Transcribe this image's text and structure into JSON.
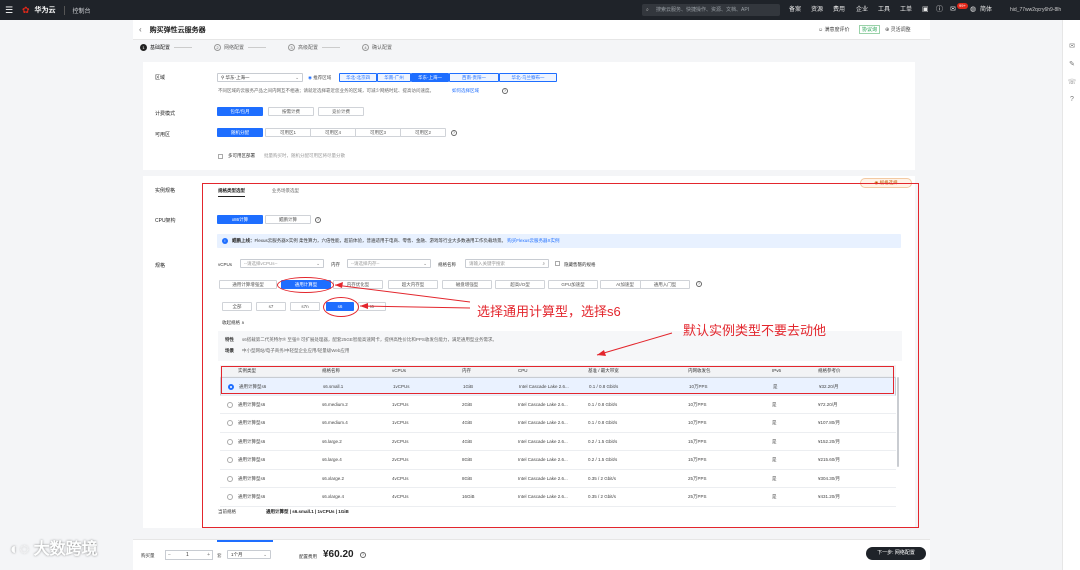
{
  "topbar": {
    "menu_icon": "☰",
    "logo": "✿",
    "brand": "华为云",
    "console": "控制台",
    "search_placeholder": "搜索云服务、快捷操作、资源、文档、API",
    "nav": [
      "备案",
      "资源",
      "费用",
      "企业",
      "工具",
      "工单"
    ],
    "badge": "99+",
    "lang": "简体",
    "user": "hid_77ww2qcry6h9-8lh"
  },
  "header": {
    "back": "‹",
    "title": "购买弹性云服务器",
    "eval": "满意度评价",
    "service": "协议询",
    "flag": "灵活调整"
  },
  "steps": [
    {
      "n": "1",
      "label": "基础配置"
    },
    {
      "n": "2",
      "label": "网络配置"
    },
    {
      "n": "3",
      "label": "高级配置"
    },
    {
      "n": "4",
      "label": "确认配置"
    }
  ],
  "region": {
    "label": "区域",
    "value": "华东-上海一",
    "recommend": "推荐区域",
    "options": [
      "华北-北京四",
      "华南-广州",
      "华东-上海一",
      "西南-贵阳一",
      "华北-乌兰察布一"
    ],
    "note": "不同区域的云服务产品之间内网互不相通；请就近选择靠近您业务的区域，可减少网络时延、提高访问速度。",
    "note_link": "如何选择区域"
  },
  "billing": {
    "label": "计费模式",
    "options": [
      "包年/包月",
      "按需计费",
      "竞价计费"
    ]
  },
  "az": {
    "label": "可用区",
    "options": [
      "随机分配",
      "可用区1",
      "可用区4",
      "可用区3",
      "可用区2"
    ],
    "multi_label": "多可用区部署",
    "multi_note": "批量购买时，随机分配可用区将尽量分散"
  },
  "instance": {
    "label": "实例规格",
    "tabs": [
      "规格类型选型",
      "业务场景选型"
    ],
    "float_btn": "◉ 规格选择"
  },
  "cpu": {
    "label": "CPU架构",
    "options": [
      "x86计算",
      "鲲鹏计算"
    ]
  },
  "info": {
    "bold": "鲲鹏上线：",
    "text": "Flexus云服务器X实例 柔性算力，六倍性能，超前体验，普遍适用于电商、零售、金融、游戏等行业大多数通用工作负载场景。",
    "link": "购买Flexus云服务器X实例"
  },
  "spec": {
    "label": "规格",
    "vcpu_label": "vCPUs",
    "vcpu_placeholder": "--请选择vCPUs--",
    "mem_label": "内存",
    "mem_placeholder": "--请选择内存--",
    "name_label": "规格名称",
    "name_placeholder": "请输入关键字搜索",
    "hide_soldout": "隐藏售罄的规格"
  },
  "families": [
    "通用计算增强型",
    "通用计算型",
    "内存优化型",
    "超大内存型",
    "磁盘增强型",
    "超高I/O型",
    "GPU加速型",
    "AI加速型",
    "通用入门型"
  ],
  "subfamilies": [
    "全部",
    "s7",
    "s7n",
    "s6",
    "t6"
  ],
  "collapse": "收起规格 ∧",
  "features": [
    {
      "k": "特性",
      "v": "s6搭载第二代英特尔® 至强® 可扩展处理器，配套25GE智能高速网卡，提供高性价比和PPS收发包能力，满足通用型业务需求。"
    },
    {
      "k": "场景",
      "v": "中小型网站/电子商务/中轻型企业应用/轻量级Web应用"
    }
  ],
  "table": {
    "headers": [
      "实例类型",
      "规格名称",
      "vCPUs",
      "内存",
      "CPU",
      "基准 / 最大带宽",
      "内网收发包",
      "IPv6",
      "规格参考价"
    ],
    "rows": [
      [
        "通用计算型s6",
        "s6.small.1",
        "1vCPUs",
        "1GiB",
        "Intel Cascade Lake 2.6...",
        "0.1 / 0.8 Gbit/s",
        "10万PPS",
        "是",
        "¥32.20/月"
      ],
      [
        "通用计算型s6",
        "s6.medium.2",
        "1vCPUs",
        "2GiB",
        "Intel Cascade Lake 2.6...",
        "0.1 / 0.8 Gbit/s",
        "10万PPS",
        "是",
        "¥72.20/月"
      ],
      [
        "通用计算型s6",
        "s6.medium.4",
        "1vCPUs",
        "4GiB",
        "Intel Cascade Lake 2.6...",
        "0.1 / 0.8 Gbit/s",
        "10万PPS",
        "是",
        "¥107.80/月"
      ],
      [
        "通用计算型s6",
        "s6.large.2",
        "2vCPUs",
        "4GiB",
        "Intel Cascade Lake 2.6...",
        "0.2 / 1.5 Gbit/s",
        "15万PPS",
        "是",
        "¥152.20/月"
      ],
      [
        "通用计算型s6",
        "s6.large.4",
        "2vCPUs",
        "8GiB",
        "Intel Cascade Lake 2.6...",
        "0.2 / 1.5 Gbit/s",
        "15万PPS",
        "是",
        "¥215.60/月"
      ],
      [
        "通用计算型s6",
        "s6.xlarge.2",
        "4vCPUs",
        "8GiB",
        "Intel Cascade Lake 2.6...",
        "0.35 / 2 Gbit/s",
        "25万PPS",
        "是",
        "¥304.30/月"
      ],
      [
        "通用计算型s6",
        "s6.xlarge.4",
        "4vCPUs",
        "16GiB",
        "Intel Cascade Lake 2.6...",
        "0.35 / 2 Gbit/s",
        "25万PPS",
        "是",
        "¥431.20/月"
      ]
    ]
  },
  "current": {
    "label": "当前规格",
    "value": "通用计算型 | s6.small.1 | 1vCPUs | 1GiB"
  },
  "annotations": {
    "a1": "选择通用计算型，选择s6",
    "a2": "默认实例类型不要去动他"
  },
  "bottom": {
    "qty_label": "购买量",
    "qty": "1",
    "duration": "1个月",
    "price_label": "配置费用",
    "price": "¥60.20",
    "next": "下一步: 网络配置"
  },
  "watermark": "大数跨境",
  "colors": {
    "accent": "#1e6eff",
    "annotation": "#e3262d",
    "topbar": "#1f2329"
  }
}
